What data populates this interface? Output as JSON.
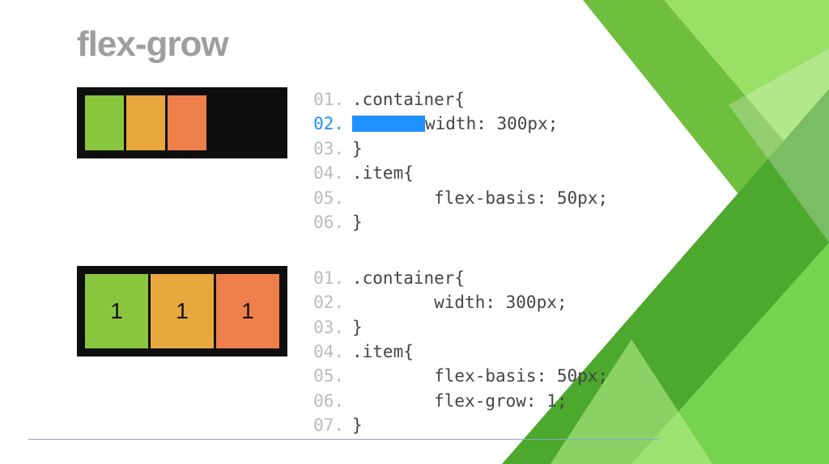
{
  "title": "flex-grow",
  "example1": {
    "boxes": [
      "",
      "",
      ""
    ],
    "code": [
      {
        "n": "01.",
        "t": ".container{",
        "hl": false
      },
      {
        "n": "02.",
        "t": "width: 300px;",
        "hl": true,
        "bar": true
      },
      {
        "n": "03.",
        "t": "}",
        "hl": false
      },
      {
        "n": "04.",
        "t": ".item{",
        "hl": false
      },
      {
        "n": "05.",
        "t": "        flex-basis: 50px;",
        "hl": false
      },
      {
        "n": "06.",
        "t": "}",
        "hl": false
      }
    ]
  },
  "example2": {
    "boxes": [
      "1",
      "1",
      "1"
    ],
    "code": [
      {
        "n": "01.",
        "t": ".container{",
        "hl": false
      },
      {
        "n": "02.",
        "t": "        width: 300px;",
        "hl": false
      },
      {
        "n": "03.",
        "t": "}",
        "hl": false
      },
      {
        "n": "04.",
        "t": ".item{",
        "hl": false
      },
      {
        "n": "05.",
        "t": "        flex-basis: 50px;",
        "hl": false
      },
      {
        "n": "06.",
        "t": "        flex-grow: 1;",
        "hl": false
      },
      {
        "n": "07.",
        "t": "}",
        "hl": false
      }
    ]
  }
}
